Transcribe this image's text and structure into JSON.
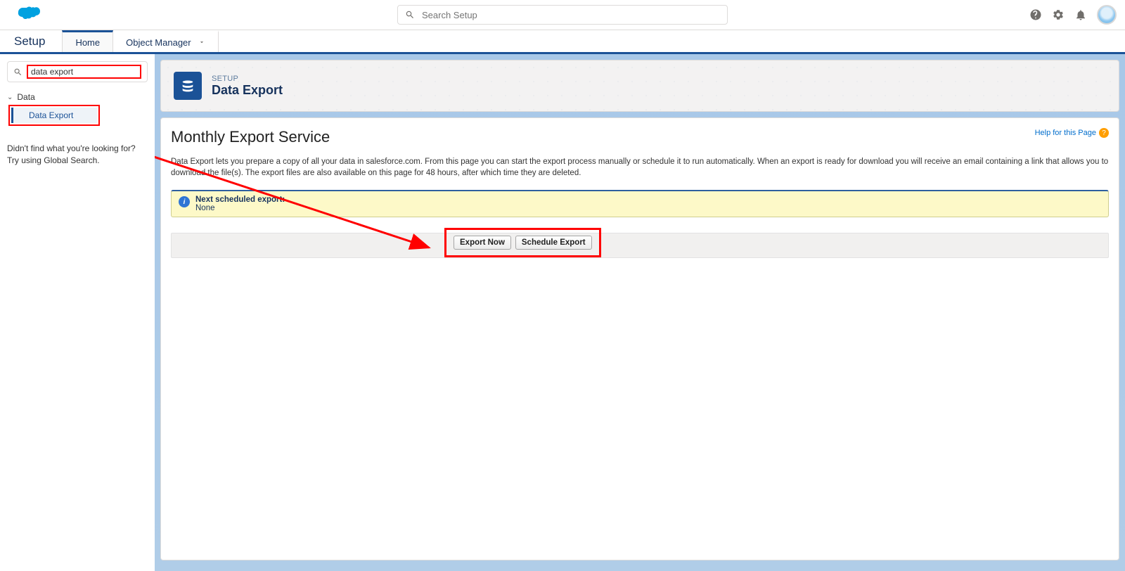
{
  "header": {
    "search_placeholder": "Search Setup"
  },
  "nav": {
    "title": "Setup",
    "tabs": [
      {
        "label": "Home",
        "active": true
      },
      {
        "label": "Object Manager",
        "active": false
      }
    ]
  },
  "sidebar": {
    "quickfind_value": "data export",
    "categories": [
      {
        "label": "Data",
        "items": [
          {
            "label": "Data Export"
          }
        ]
      }
    ],
    "notfound_line1": "Didn't find what you're looking for?",
    "notfound_line2": "Try using Global Search."
  },
  "page_header": {
    "crumb": "SETUP",
    "title": "Data Export"
  },
  "content": {
    "service_title": "Monthly Export Service",
    "help_label": "Help for this Page",
    "description": "Data Export lets you prepare a copy of all your data in salesforce.com. From this page you can start the export process manually or schedule it to run automatically. When an export is ready for download you will receive an email containing a link that allows you to download the file(s). The export files are also available on this page for 48 hours, after which time they are deleted.",
    "next_export_label": "Next scheduled export:",
    "next_export_value": "None",
    "buttons": {
      "export_now": "Export Now",
      "schedule_export": "Schedule Export"
    }
  }
}
